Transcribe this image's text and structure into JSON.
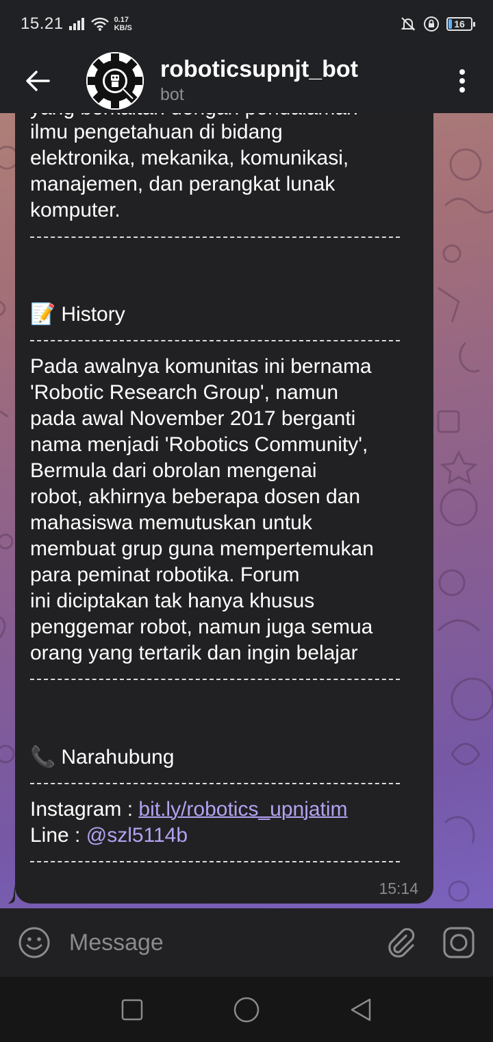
{
  "status_bar": {
    "time": "15.21",
    "net_speed_value": "0.17",
    "net_speed_unit": "KB/S",
    "battery": "16"
  },
  "header": {
    "title": "roboticsupnjt_bot",
    "subtitle": "bot"
  },
  "message": {
    "cut_line": "yang berkaitan dengan pendalaman",
    "intro": "ilmu pengetahuan di bidang\nelektronika, mekanika, komunikasi,\nmanajemen, dan perangkat lunak\nkomputer.",
    "history_emoji": "📝",
    "history_title": "History",
    "history_body": "Pada awalnya komunitas ini bernama\n'Robotic Research Group', namun\npada awal November 2017 berganti\nnama menjadi 'Robotics Community',\nBermula dari obrolan mengenai\nrobot, akhirnya beberapa dosen dan\nmahasiswa memutuskan untuk\nmembuat grup guna mempertemukan\npara peminat robotika. Forum\nini diciptakan tak hanya khusus\npenggemar robot, namun juga semua\norang yang tertarik dan ingin belajar",
    "contact_emoji": "📞",
    "contact_title": "Narahubung",
    "instagram_label": "Instagram : ",
    "instagram_link": "bit.ly/robotics_upnjatim",
    "line_label": "Line : ",
    "line_id": "@szl5114b",
    "time": "15:14"
  },
  "input": {
    "placeholder": "Message"
  },
  "colors": {
    "link": "#b4a2f2",
    "bubble": "#212123",
    "bar": "#202124"
  }
}
